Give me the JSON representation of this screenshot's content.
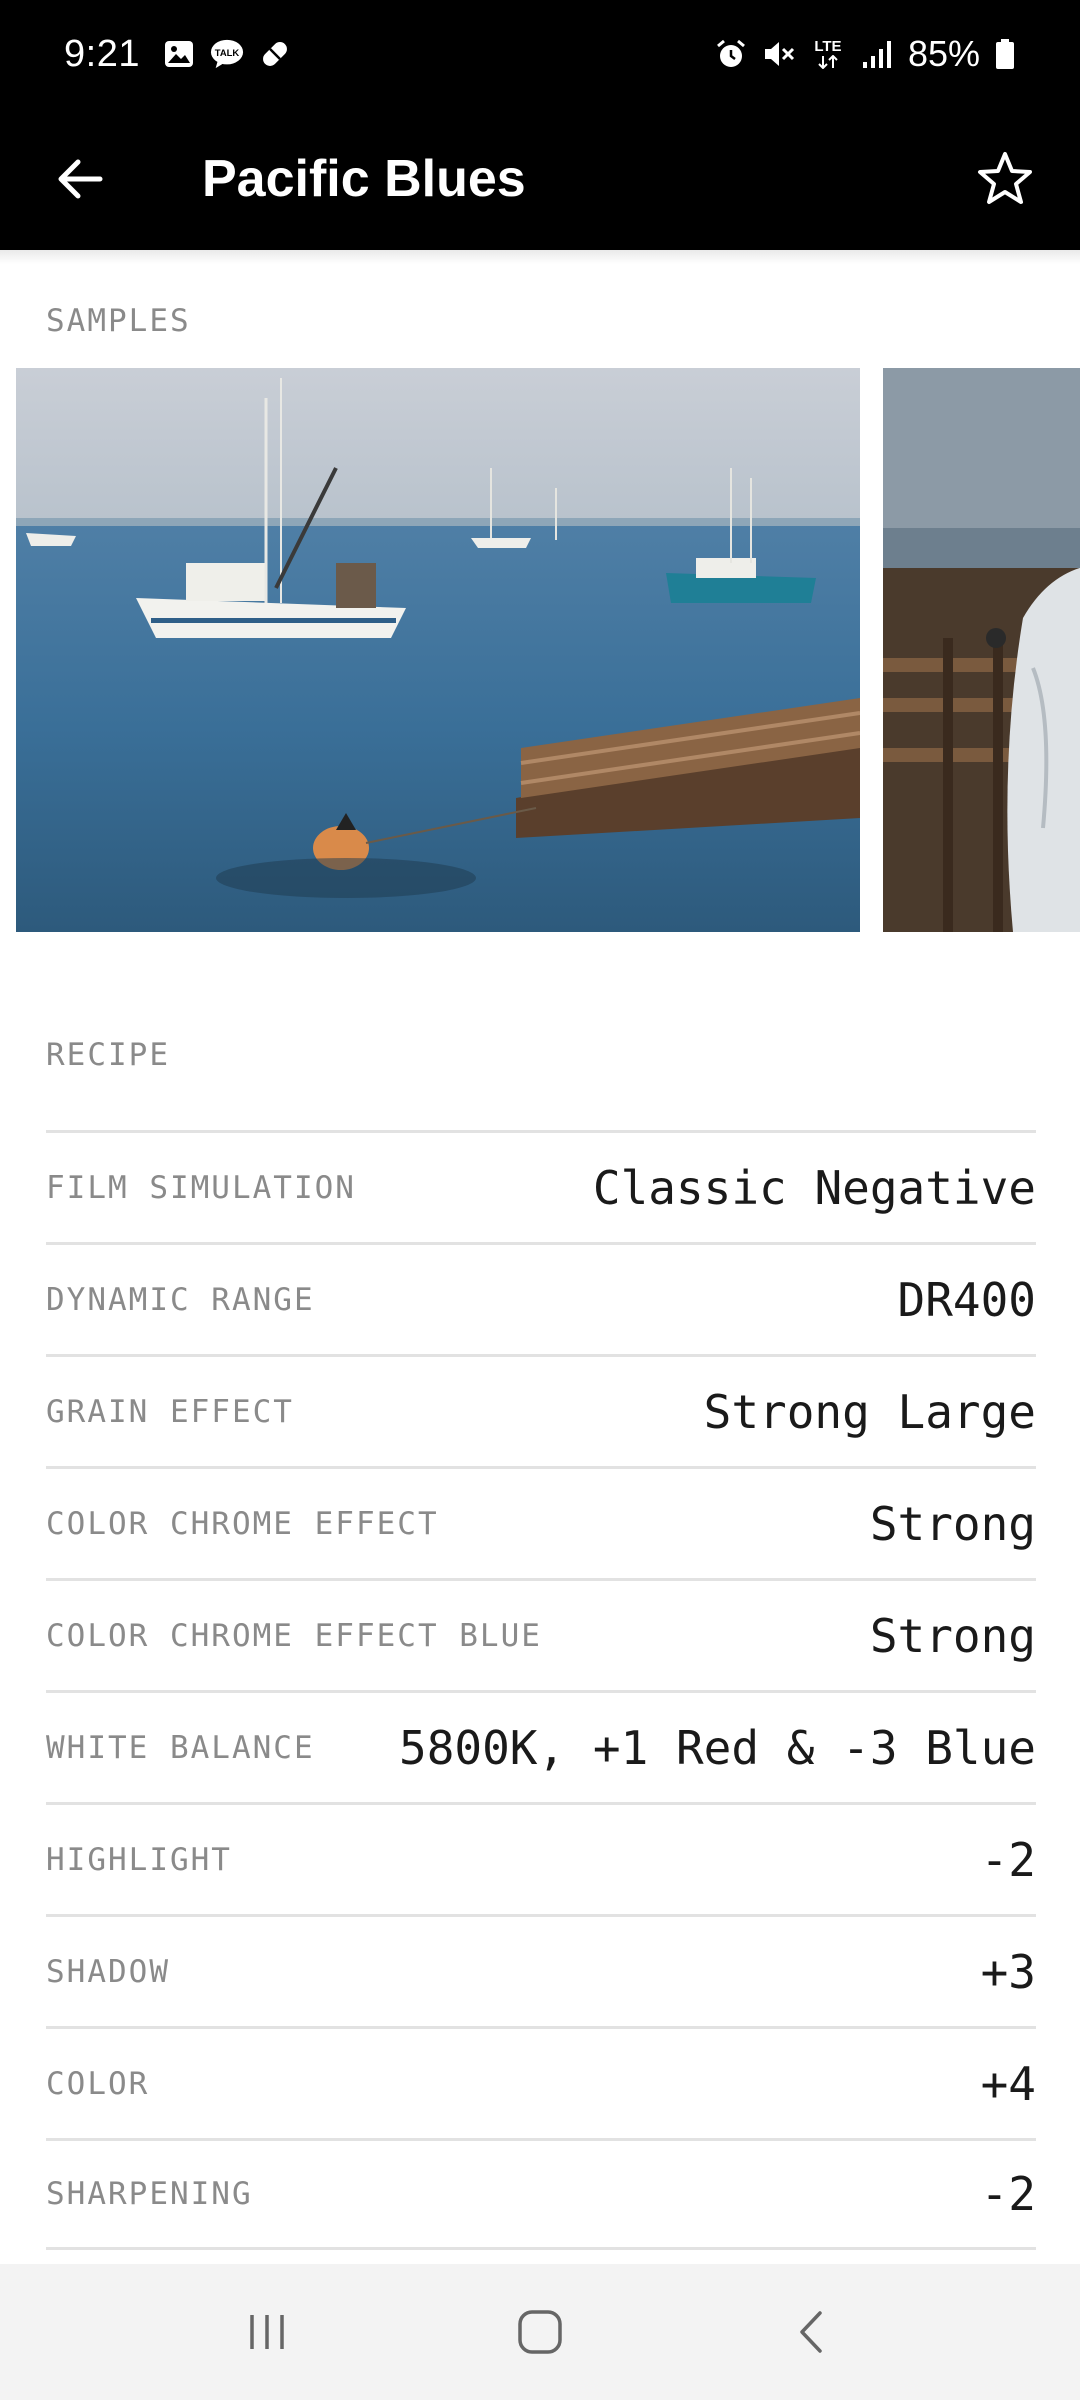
{
  "status_bar": {
    "time": "9:21",
    "battery": "85%",
    "left_icons": [
      "gallery-icon",
      "talk-icon",
      "pill-icon"
    ],
    "right_icons": [
      "alarm-icon",
      "mute-icon",
      "lte-icon",
      "signal-icon",
      "battery-icon"
    ],
    "lte_label": "LTE"
  },
  "app_bar": {
    "title": "Pacific Blues",
    "back_icon": "arrow-left-icon",
    "favorite_icon": "star-outline-icon"
  },
  "samples": {
    "label": "SAMPLES"
  },
  "recipe": {
    "label": "RECIPE",
    "rows": [
      {
        "label": "FILM SIMULATION",
        "value": "Classic Negative"
      },
      {
        "label": "DYNAMIC RANGE",
        "value": "DR400"
      },
      {
        "label": "GRAIN EFFECT",
        "value": "Strong Large"
      },
      {
        "label": "COLOR CHROME EFFECT",
        "value": "Strong"
      },
      {
        "label": "COLOR CHROME EFFECT BLUE",
        "value": "Strong"
      },
      {
        "label": "WHITE BALANCE",
        "value": "5800K, +1 Red & -3 Blue"
      },
      {
        "label": "HIGHLIGHT",
        "value": "-2"
      },
      {
        "label": "SHADOW",
        "value": "+3"
      },
      {
        "label": "COLOR",
        "value": "+4"
      },
      {
        "label": "SHARPENING",
        "value": "-2"
      }
    ]
  },
  "nav_bar": {
    "icons": [
      "recents-icon",
      "home-icon",
      "back-icon"
    ]
  },
  "colors": {
    "header_bg": "#000000",
    "label_gray": "#8a8a8a",
    "divider": "#e2e2e2",
    "nav_bg": "#f3f3f3"
  }
}
